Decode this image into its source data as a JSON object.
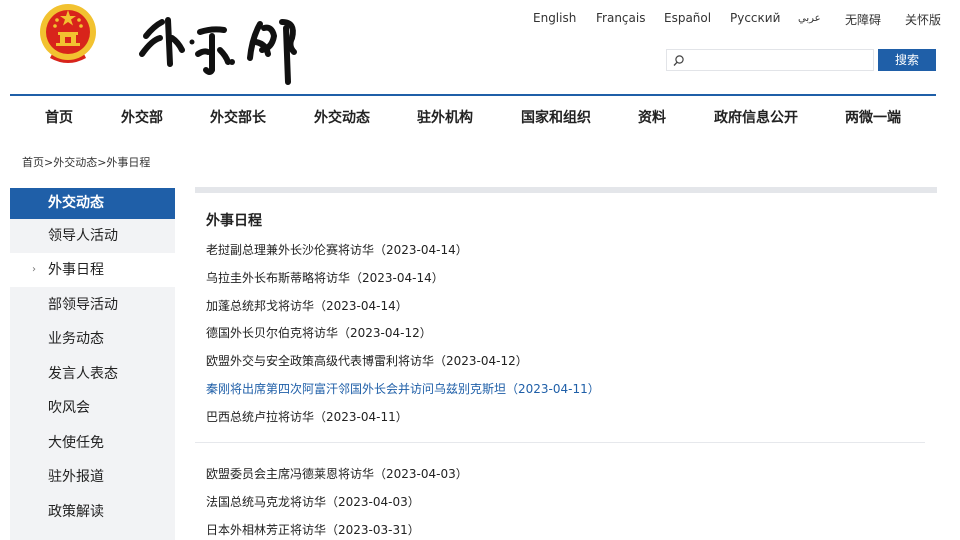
{
  "header": {
    "calligraphy_text": "外交部",
    "colors": {
      "brand_blue": "#1f5fa8",
      "emblem_red": "#d8241b",
      "emblem_gold": "#f2c230"
    },
    "languages": [
      "English",
      "Français",
      "Español",
      "Русский",
      "عربي",
      "无障碍",
      "关怀版"
    ],
    "search": {
      "placeholder": "",
      "button_label": "搜索"
    }
  },
  "nav": {
    "items": [
      "首页",
      "外交部",
      "外交部长",
      "外交动态",
      "驻外机构",
      "国家和组织",
      "资料",
      "政府信息公开",
      "两微一端"
    ]
  },
  "breadcrumb": "首页>外交动态>外事日程",
  "sidebar": {
    "title": "外交动态",
    "items": [
      "领导人活动",
      "外事日程",
      "部领导活动",
      "业务动态",
      "发言人表态",
      "吹风会",
      "大使任免",
      "驻外报道",
      "政策解读"
    ],
    "current_arrow": "›"
  },
  "content": {
    "title": "外事日程",
    "items": [
      "老挝副总理兼外长沙伦赛将访华（2023-04-14）",
      "乌拉圭外长布斯蒂略将访华（2023-04-14）",
      "加蓬总统邦戈将访华（2023-04-14）",
      "德国外长贝尔伯克将访华（2023-04-12）",
      "欧盟外交与安全政策高级代表博雷利将访华（2023-04-12）",
      "秦刚将出席第四次阿富汗邻国外长会并访问乌兹别克斯坦（2023-04-11）",
      "巴西总统卢拉将访华（2023-04-11）",
      "欧盟委员会主席冯德莱恩将访华（2023-04-03）",
      "法国总统马克龙将访华（2023-04-03）",
      "日本外相林芳正将访华（2023-03-31）"
    ]
  }
}
